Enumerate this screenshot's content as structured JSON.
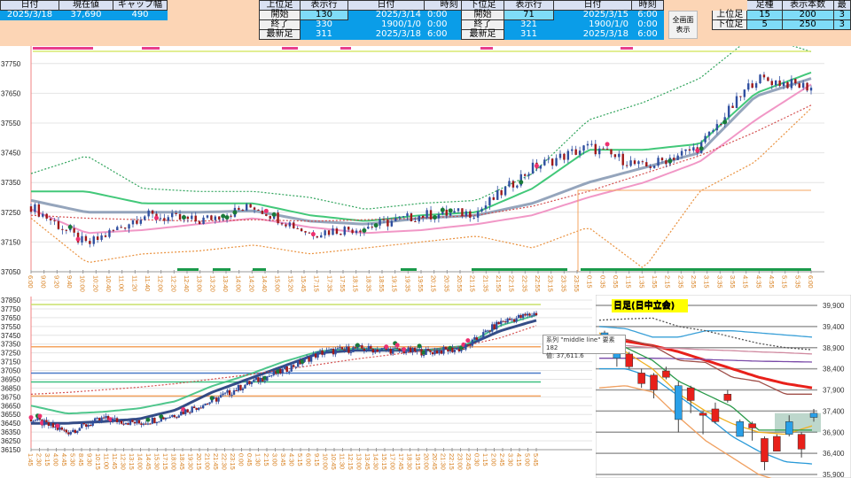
{
  "header": {
    "summary": {
      "headers": [
        "日付",
        "現在値",
        "ギャップ幅"
      ],
      "values": [
        "2025/3/18",
        "37,690",
        "490"
      ]
    },
    "upper": {
      "headers": [
        "上位足",
        "表示行",
        "日付",
        "時刻"
      ],
      "rows": [
        [
          "開始",
          "130",
          "2025/3/14",
          "0:00"
        ],
        [
          "終了",
          "330",
          "1900/1/0",
          "0:00"
        ],
        [
          "最新足",
          "311",
          "2025/3/18",
          "6:00"
        ]
      ]
    },
    "lower": {
      "headers": [
        "下位足",
        "表示行",
        "日付",
        "時刻"
      ],
      "rows": [
        [
          "開始",
          "71",
          "2025/3/15",
          "6:00"
        ],
        [
          "終了",
          "321",
          "1900/1/0",
          "0:00"
        ],
        [
          "最新足",
          "311",
          "2025/3/18",
          "6:00"
        ]
      ]
    },
    "fullscreen_button": "全画面表示",
    "settings": {
      "headers": [
        "",
        "足種",
        "表示本数",
        "最"
      ],
      "rows": [
        [
          "上位足",
          "15",
          "200",
          "3"
        ],
        [
          "下位足",
          "5",
          "250",
          "3"
        ]
      ]
    }
  },
  "tooltip": {
    "line1": "系列 \"middle line\" 要素 182",
    "line2": "値: 37,611.6"
  },
  "daily_title": "日足(日中立会)",
  "chart_data": [
    {
      "type": "line",
      "name": "upper-timeframe-15min",
      "yticks": [
        "37050",
        "37150",
        "37250",
        "37350",
        "37450",
        "37550",
        "37650",
        "37750"
      ],
      "ylim": [
        37050,
        37800
      ],
      "xticks": [
        "6:00",
        "9:00",
        "9:20",
        "9:40",
        "10:00",
        "10:20",
        "10:40",
        "11:00",
        "11:20",
        "11:40",
        "12:00",
        "12:20",
        "12:40",
        "13:00",
        "13:20",
        "13:40",
        "14:00",
        "14:20",
        "14:40",
        "15:00",
        "15:20",
        "15:45",
        "17:15",
        "17:35",
        "17:55",
        "18:15",
        "18:35",
        "18:55",
        "19:15",
        "19:35",
        "19:55",
        "20:15",
        "20:35",
        "20:55",
        "21:15",
        "21:35",
        "21:55",
        "22:15",
        "22:35",
        "22:55",
        "23:15",
        "23:35",
        "23:55",
        "0:15",
        "0:35",
        "0:55",
        "1:15",
        "1:35",
        "1:55",
        "2:15",
        "2:35",
        "2:55",
        "3:15",
        "3:35",
        "3:55",
        "4:15",
        "4:35",
        "4:55",
        "5:15",
        "5:35",
        "6:00"
      ],
      "series": [
        {
          "name": "close",
          "color": "#2f4fa0",
          "values": [
            37270,
            37140,
            37240,
            37220,
            37270,
            37180,
            37200,
            37240,
            37250,
            37400,
            37470,
            37400,
            37470,
            37700,
            37670
          ]
        },
        {
          "name": "middle",
          "color": "#8a9bb5",
          "values": [
            37290,
            37250,
            37250,
            37250,
            37255,
            37220,
            37210,
            37230,
            37240,
            37280,
            37350,
            37400,
            37450,
            37640,
            37700
          ]
        },
        {
          "name": "ma-green",
          "color": "#2ec26a",
          "values": [
            37320,
            37320,
            37280,
            37280,
            37280,
            37240,
            37220,
            37240,
            37250,
            37330,
            37460,
            37460,
            37480,
            37650,
            37720
          ]
        },
        {
          "name": "ma-pink",
          "color": "#f08cc0",
          "values": [
            37260,
            37180,
            37190,
            37210,
            37230,
            37200,
            37180,
            37190,
            37210,
            37240,
            37300,
            37350,
            37420,
            37560,
            37680
          ]
        },
        {
          "name": "band-upper",
          "color": "#1a9a4a",
          "dash": true,
          "values": [
            37380,
            37440,
            37330,
            37320,
            37320,
            37300,
            37260,
            37280,
            37290,
            37380,
            37560,
            37620,
            37700,
            37850,
            37790
          ]
        },
        {
          "name": "band-lower",
          "color": "#e8862a",
          "dash": true,
          "values": [
            37230,
            37080,
            37110,
            37120,
            37140,
            37110,
            37130,
            37150,
            37170,
            37130,
            37200,
            37060,
            37320,
            37420,
            37600
          ]
        },
        {
          "name": "trend",
          "color": "#d04040",
          "dash": true,
          "values": [
            37240,
            37230,
            37225,
            37220,
            37225,
            37220,
            37225,
            37230,
            37240,
            37270,
            37320,
            37380,
            37440,
            37520,
            37610
          ]
        }
      ]
    },
    {
      "type": "line",
      "name": "lower-timeframe-5min",
      "yticks": [
        "36150",
        "36250",
        "36350",
        "36450",
        "36550",
        "36650",
        "36750",
        "36850",
        "36950",
        "37050",
        "37150",
        "37250",
        "37350",
        "37450",
        "37550",
        "37650",
        "37750",
        "37850"
      ],
      "ylim": [
        36150,
        37850
      ],
      "xticks": [
        "1:45",
        "2:30",
        "3:15",
        "4:00",
        "4:45",
        "5:30",
        "8:45",
        "9:30",
        "10:15",
        "11:00",
        "11:45",
        "12:30",
        "13:15",
        "14:00",
        "14:45",
        "15:30",
        "17:15",
        "18:00",
        "18:45",
        "19:30",
        "20:15",
        "21:00",
        "21:45",
        "22:30",
        "23:15",
        "0:00",
        "0:45",
        "1:30",
        "2:15",
        "3:00",
        "3:45",
        "4:30",
        "5:15",
        "6:00",
        "9:15",
        "10:00",
        "10:45",
        "11:30",
        "12:15",
        "13:00",
        "13:45",
        "14:30",
        "15:15",
        "17:00",
        "17:45",
        "18:30",
        "19:15",
        "20:00",
        "20:45",
        "21:30",
        "22:15",
        "23:00",
        "23:45",
        "0:30",
        "1:15",
        "2:00",
        "2:45",
        "3:30",
        "4:15",
        "5:00",
        "5:45"
      ],
      "hlines": [
        {
          "value": 37800,
          "color": "#c8e06a"
        },
        {
          "value": 37320,
          "color": "#f4a460"
        },
        {
          "value": 37020,
          "color": "#4a7ac8"
        },
        {
          "value": 36920,
          "color": "#3cc080"
        },
        {
          "value": 36760,
          "color": "#f4a460"
        }
      ],
      "series": [
        {
          "name": "close",
          "color": "#2f4fa0",
          "values": [
            36500,
            36350,
            36500,
            36450,
            36550,
            36700,
            36900,
            37050,
            37250,
            37300,
            37280,
            37260,
            37300,
            37600,
            37700
          ]
        },
        {
          "name": "middle line",
          "color": "#1f3a7a",
          "values": [
            36450,
            36450,
            36470,
            36500,
            36600,
            36800,
            36950,
            37100,
            37250,
            37280,
            37280,
            37280,
            37320,
            37500,
            37620
          ]
        },
        {
          "name": "ma-green",
          "color": "#3cc080",
          "values": [
            36650,
            36560,
            36580,
            36620,
            36700,
            36870,
            37000,
            37150,
            37270,
            37300,
            37290,
            37280,
            37330,
            37560,
            37680
          ]
        },
        {
          "name": "trend",
          "color": "#d04040",
          "dash": true,
          "values": [
            36780,
            36800,
            36830,
            36860,
            36900,
            36950,
            37000,
            37060,
            37120,
            37180,
            37230,
            37280,
            37330,
            37420,
            37560
          ]
        }
      ]
    },
    {
      "type": "candlestick",
      "name": "daily",
      "title": "日足(日中立会)",
      "yticks": [
        "35,900",
        "36,400",
        "36,900",
        "37,400",
        "37,900",
        "38,400",
        "38,900",
        "39,400",
        "39,900"
      ],
      "ylim": [
        35900,
        39900
      ],
      "candles": [
        [
          39150,
          39250,
          39300,
          39100
        ],
        [
          38650,
          38900,
          39000,
          38450
        ],
        [
          38750,
          38450,
          38800,
          38400
        ],
        [
          38300,
          38050,
          38400,
          37950
        ],
        [
          38250,
          37900,
          38300,
          37700
        ],
        [
          38350,
          38200,
          38450,
          38150
        ],
        [
          37200,
          38000,
          38100,
          36900
        ],
        [
          37950,
          37650,
          38000,
          37350
        ],
        [
          37350,
          37300,
          37400,
          36850
        ],
        [
          37450,
          37150,
          37600,
          37100
        ],
        [
          37800,
          37650,
          37900,
          37600
        ],
        [
          36800,
          37150,
          37200,
          36800
        ],
        [
          37100,
          37000,
          37150,
          36700
        ],
        [
          36750,
          36200,
          36800,
          36000
        ],
        [
          36800,
          36450,
          36850,
          36450
        ],
        [
          36850,
          37150,
          37300,
          36800
        ],
        [
          36850,
          36500,
          36900,
          36300
        ],
        [
          37250,
          37350,
          37450,
          37150
        ]
      ],
      "series": [
        {
          "name": "ma-red",
          "color": "#e8201a",
          "width": 3,
          "values": [
            39100,
            39050,
            38950,
            38800,
            38600,
            38400,
            38200,
            38050,
            37950
          ]
        },
        {
          "name": "ma-purple",
          "color": "#7a4aa8",
          "values": [
            38650,
            38650,
            38650,
            38640,
            38620,
            38600,
            38580,
            38570,
            38560
          ]
        },
        {
          "name": "ma-pink",
          "color": "#d08aa0",
          "values": [
            38950,
            38950,
            38900,
            38880,
            38850,
            38830,
            38800,
            38780,
            38750
          ]
        },
        {
          "name": "brown",
          "color": "#a0504a",
          "values": [
            39200,
            39100,
            38950,
            38600,
            38550,
            38200,
            38100,
            37800,
            37800
          ]
        },
        {
          "name": "band-top",
          "color": "#3aa0d8",
          "values": [
            39400,
            39350,
            39150,
            39150,
            39300,
            39300,
            39250,
            39200,
            39150
          ]
        },
        {
          "name": "yellow",
          "color": "#f0b020",
          "values": [
            39250,
            38800,
            38400,
            37800,
            37400,
            37100,
            36900,
            36850,
            37050
          ]
        },
        {
          "name": "green",
          "color": "#2a9a4a",
          "values": [
            39200,
            38900,
            38600,
            38100,
            37800,
            37500,
            36950,
            36950,
            36950
          ]
        },
        {
          "name": "blue-lower",
          "color": "#2a9ad8",
          "values": [
            38400,
            38400,
            38200,
            37750,
            37300,
            36800,
            36450,
            36200,
            36150
          ]
        },
        {
          "name": "orange-lower",
          "color": "#f0a060",
          "values": [
            37950,
            38000,
            37850,
            37250,
            36700,
            36300,
            35900,
            35700,
            35600
          ]
        },
        {
          "name": "dotted",
          "color": "#555555",
          "dash": true,
          "values": [
            39550,
            39580,
            39600,
            39400,
            39300,
            39150,
            39000,
            38900,
            38850
          ]
        }
      ]
    }
  ]
}
